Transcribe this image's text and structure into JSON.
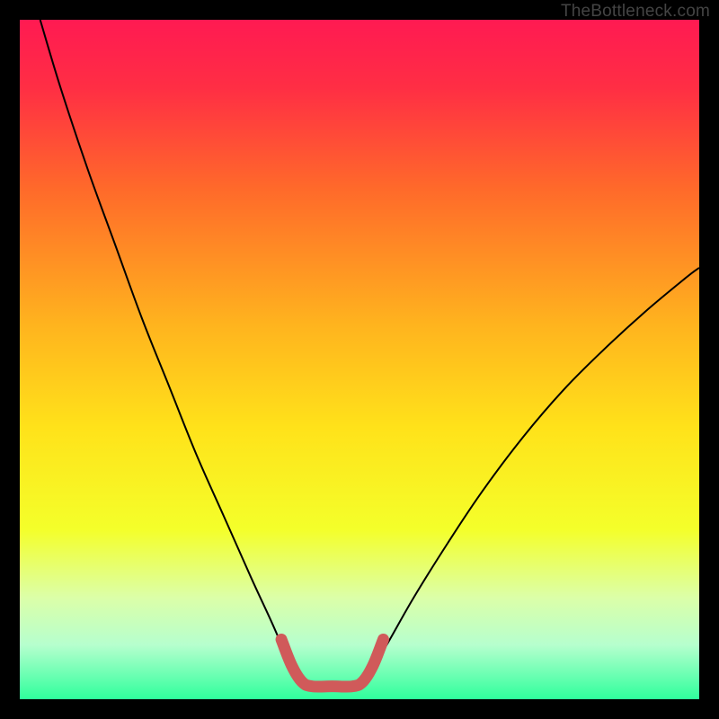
{
  "watermark": "TheBottleneck.com",
  "chart_data": {
    "type": "line",
    "title": "",
    "xlabel": "",
    "ylabel": "",
    "xlim": [
      0,
      100
    ],
    "ylim": [
      0,
      100
    ],
    "background_gradient": {
      "stops": [
        {
          "offset": 0.0,
          "color": "#ff1a52"
        },
        {
          "offset": 0.1,
          "color": "#ff2e44"
        },
        {
          "offset": 0.25,
          "color": "#ff6a2a"
        },
        {
          "offset": 0.45,
          "color": "#ffb41e"
        },
        {
          "offset": 0.6,
          "color": "#ffe21a"
        },
        {
          "offset": 0.75,
          "color": "#f4ff2a"
        },
        {
          "offset": 0.85,
          "color": "#dcffa8"
        },
        {
          "offset": 0.92,
          "color": "#b6ffce"
        },
        {
          "offset": 1.0,
          "color": "#2fff9c"
        }
      ]
    },
    "series": [
      {
        "name": "bottleneck-curve-left",
        "stroke": "#000000",
        "stroke_width": 2,
        "points": [
          {
            "x": 3.0,
            "y": 100.0
          },
          {
            "x": 6.0,
            "y": 90.0
          },
          {
            "x": 10.0,
            "y": 78.0
          },
          {
            "x": 14.0,
            "y": 67.0
          },
          {
            "x": 18.0,
            "y": 56.0
          },
          {
            "x": 22.0,
            "y": 46.0
          },
          {
            "x": 26.0,
            "y": 36.0
          },
          {
            "x": 30.0,
            "y": 27.0
          },
          {
            "x": 34.0,
            "y": 18.0
          },
          {
            "x": 37.0,
            "y": 11.5
          },
          {
            "x": 39.0,
            "y": 7.0
          },
          {
            "x": 41.0,
            "y": 3.2
          }
        ]
      },
      {
        "name": "bottleneck-curve-right",
        "stroke": "#000000",
        "stroke_width": 2,
        "points": [
          {
            "x": 51.0,
            "y": 3.2
          },
          {
            "x": 54.0,
            "y": 8.0
          },
          {
            "x": 58.0,
            "y": 15.0
          },
          {
            "x": 63.0,
            "y": 23.0
          },
          {
            "x": 68.0,
            "y": 30.5
          },
          {
            "x": 74.0,
            "y": 38.5
          },
          {
            "x": 80.0,
            "y": 45.5
          },
          {
            "x": 86.0,
            "y": 51.5
          },
          {
            "x": 92.0,
            "y": 57.0
          },
          {
            "x": 98.0,
            "y": 62.0
          },
          {
            "x": 100.0,
            "y": 63.5
          }
        ]
      },
      {
        "name": "highlight-segment",
        "stroke": "#d05a5a",
        "stroke_width": 13,
        "linecap": "round",
        "points": [
          {
            "x": 38.5,
            "y": 8.8
          },
          {
            "x": 40.0,
            "y": 5.0
          },
          {
            "x": 41.5,
            "y": 2.6
          },
          {
            "x": 43.0,
            "y": 1.9
          },
          {
            "x": 46.0,
            "y": 1.9
          },
          {
            "x": 49.0,
            "y": 1.9
          },
          {
            "x": 50.5,
            "y": 2.6
          },
          {
            "x": 52.0,
            "y": 5.0
          },
          {
            "x": 53.5,
            "y": 8.8
          }
        ]
      }
    ]
  }
}
